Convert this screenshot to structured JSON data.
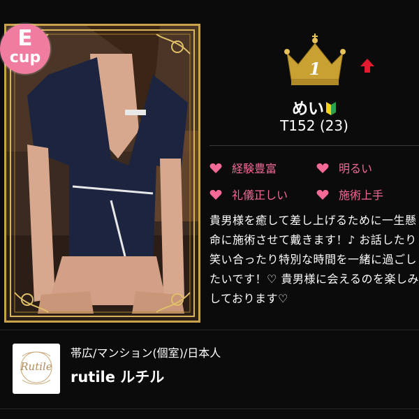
{
  "card": {
    "cup_badge": {
      "letter": "E",
      "word": "cup",
      "color": "#f07ca0"
    },
    "photo_icon": "woman-photo",
    "frame_color": "#c9a24a"
  },
  "rank": {
    "number": "1",
    "icon": "crown-icon",
    "trend_icon": "up-arrow-icon",
    "trend_color": "#e21b30"
  },
  "profile": {
    "name": "めい",
    "badge_icon": "beginner-icon",
    "stats": "T152 (23)"
  },
  "tags": [
    {
      "label": "経験豊富"
    },
    {
      "label": "明るい"
    },
    {
      "label": "礼儀正しい"
    },
    {
      "label": "施術上手"
    }
  ],
  "tag_color": "#f26a95",
  "description": "貴男様を癒して差し上げるために一生懸命に施術させて戴きます！♪ お話したり笑い合ったり特別な時間を一緒に過ごしたいです！♡ 貴男様に会えるのを楽しみしております♡",
  "shop": {
    "logo_text": "Rutile",
    "area": "帯広/マンション(個室)/日本人",
    "name": "rutile ルチル"
  }
}
